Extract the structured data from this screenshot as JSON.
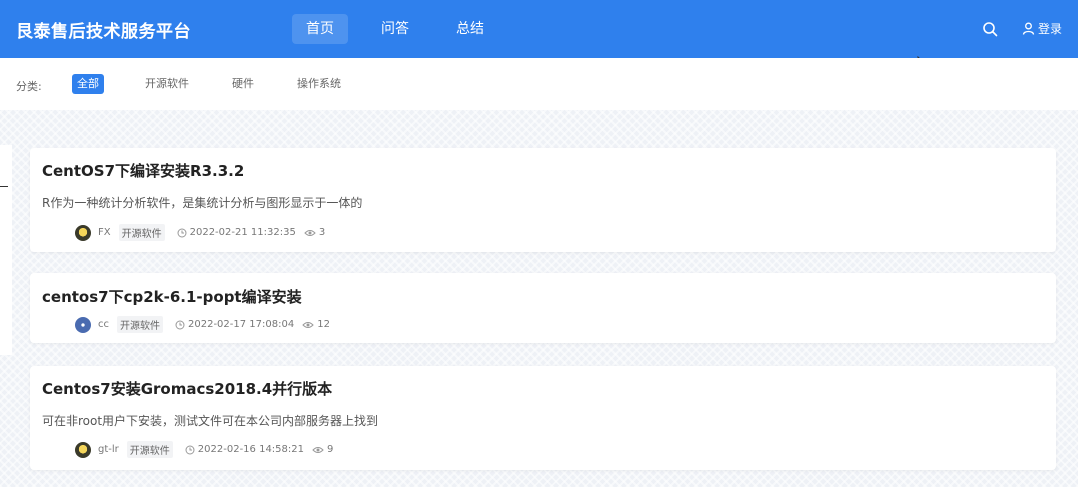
{
  "header": {
    "brand": "艮泰售后技术服务平台",
    "nav": [
      {
        "label": "首页",
        "active": true
      },
      {
        "label": "问答",
        "active": false
      },
      {
        "label": "总结",
        "active": false
      }
    ],
    "search_icon": "search-icon",
    "login_label": "登录"
  },
  "filter": {
    "label": "分类:",
    "categories": [
      {
        "label": "全部",
        "active": true
      },
      {
        "label": "开源软件",
        "active": false
      },
      {
        "label": "硬件",
        "active": false
      },
      {
        "label": "操作系统",
        "active": false
      }
    ]
  },
  "posts": [
    {
      "title": "CentOS7下编译安装R3.3.2",
      "desc": "R作为一种统计分析软件，是集统计分析与图形显示于一体的",
      "author": "FX",
      "tag": "开源软件",
      "time": "2022-02-21 11:32:35",
      "views": "3"
    },
    {
      "title": "centos7下cp2k-6.1-popt编译安装",
      "desc": "",
      "author": "cc",
      "tag": "开源软件",
      "time": "2022-02-17 17:08:04",
      "views": "12"
    },
    {
      "title": "Centos7安装Gromacs2018.4并行版本",
      "desc": "可在非root用户下安装，测试文件可在本公司内部服务器上找到",
      "author": "gt-lr",
      "tag": "开源软件",
      "time": "2022-02-16 14:58:21",
      "views": "9"
    }
  ],
  "colors": {
    "header_bg": "#2f80ed",
    "accent": "#2f80ed"
  }
}
